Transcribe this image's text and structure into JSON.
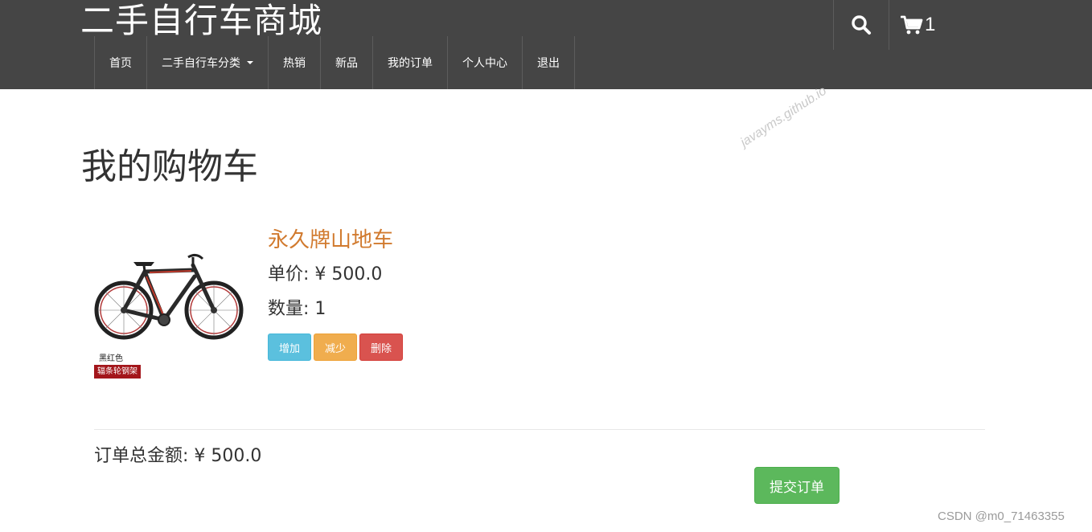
{
  "header": {
    "brand": "二手自行车商城",
    "cart_count": "1",
    "search_icon": "search-icon",
    "cart_icon": "shopping-cart-icon"
  },
  "nav": {
    "items": [
      {
        "label": "首页"
      },
      {
        "label": "二手自行车分类",
        "has_dropdown": true
      },
      {
        "label": "热销"
      },
      {
        "label": "新品"
      },
      {
        "label": "我的订单"
      },
      {
        "label": "个人中心"
      },
      {
        "label": "退出"
      }
    ]
  },
  "watermark": "javayms.github.io",
  "cart": {
    "title": "我的购物车",
    "item": {
      "name": "永久牌山地车",
      "price": "单价: ¥ 500.0",
      "quantity": "数量: 1",
      "image_labels": [
        "黑红色",
        "辐条轮钢架"
      ],
      "actions": {
        "increase": "增加",
        "decrease": "减少",
        "delete": "删除"
      }
    },
    "total": "订单总金额: ¥ 500.0",
    "submit_label": "提交订单"
  },
  "footer": {
    "credit": "CSDN @m0_71463355"
  },
  "colors": {
    "header_bg": "#454545",
    "product_name": "#d17a2e",
    "info": "#5bc0de",
    "warning": "#f0ad4e",
    "danger": "#d9534f",
    "success": "#5cb85c"
  }
}
